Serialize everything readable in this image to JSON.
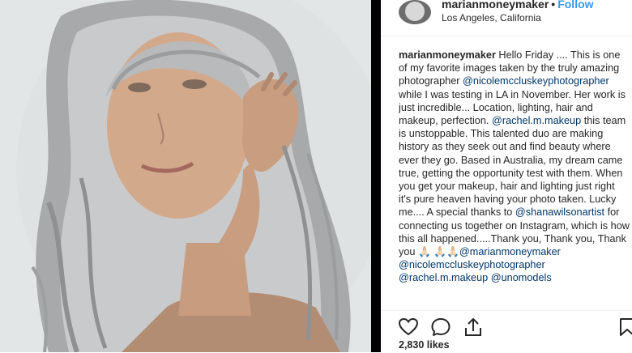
{
  "post": {
    "username": "marianmoneymaker",
    "separator": "•",
    "follow_label": "Follow",
    "location": "Los Angeles, California",
    "likes": "2,830 likes"
  },
  "caption": {
    "author": "marianmoneymaker",
    "seg1": " Hello Friday .... This is one of my favorite images taken by the truly amazing photographer ",
    "mention1": "@nicolemccluskeyphotographer",
    "seg2": " while I was testing in LA in November. Her work is just incredible... Location, lighting, hair and makeup, perfection. ",
    "mention2": "@rachel.m.makeup",
    "seg3": " this team is unstoppable. This talented duo are making history as they seek out and find beauty where ever they go. Based in Australia, my dream came true, getting the opportunity test with them. When you get your makeup, hair and lighting just right it's pure heaven having your photo taken. Lucky me.... A special thanks to ",
    "mention3": "@shanawilsonartist",
    "seg4": " for connecting us together on Instagram, which is how this all happened.....Thank you, Thank you, Thank you 🙏🏻 🙏🏻🙏🏻",
    "mention4": "@marianmoneymaker",
    "mention5": "@nicolemccluskeyphotographer",
    "mention6": "@rachel.m.makeup",
    "mention7": "@unomodels"
  },
  "icons": {
    "like": "heart-icon",
    "comment": "comment-icon",
    "share": "share-icon",
    "save": "bookmark-icon"
  },
  "colors": {
    "follow": "#3897f0",
    "mention": "#003569",
    "text": "#262626"
  }
}
